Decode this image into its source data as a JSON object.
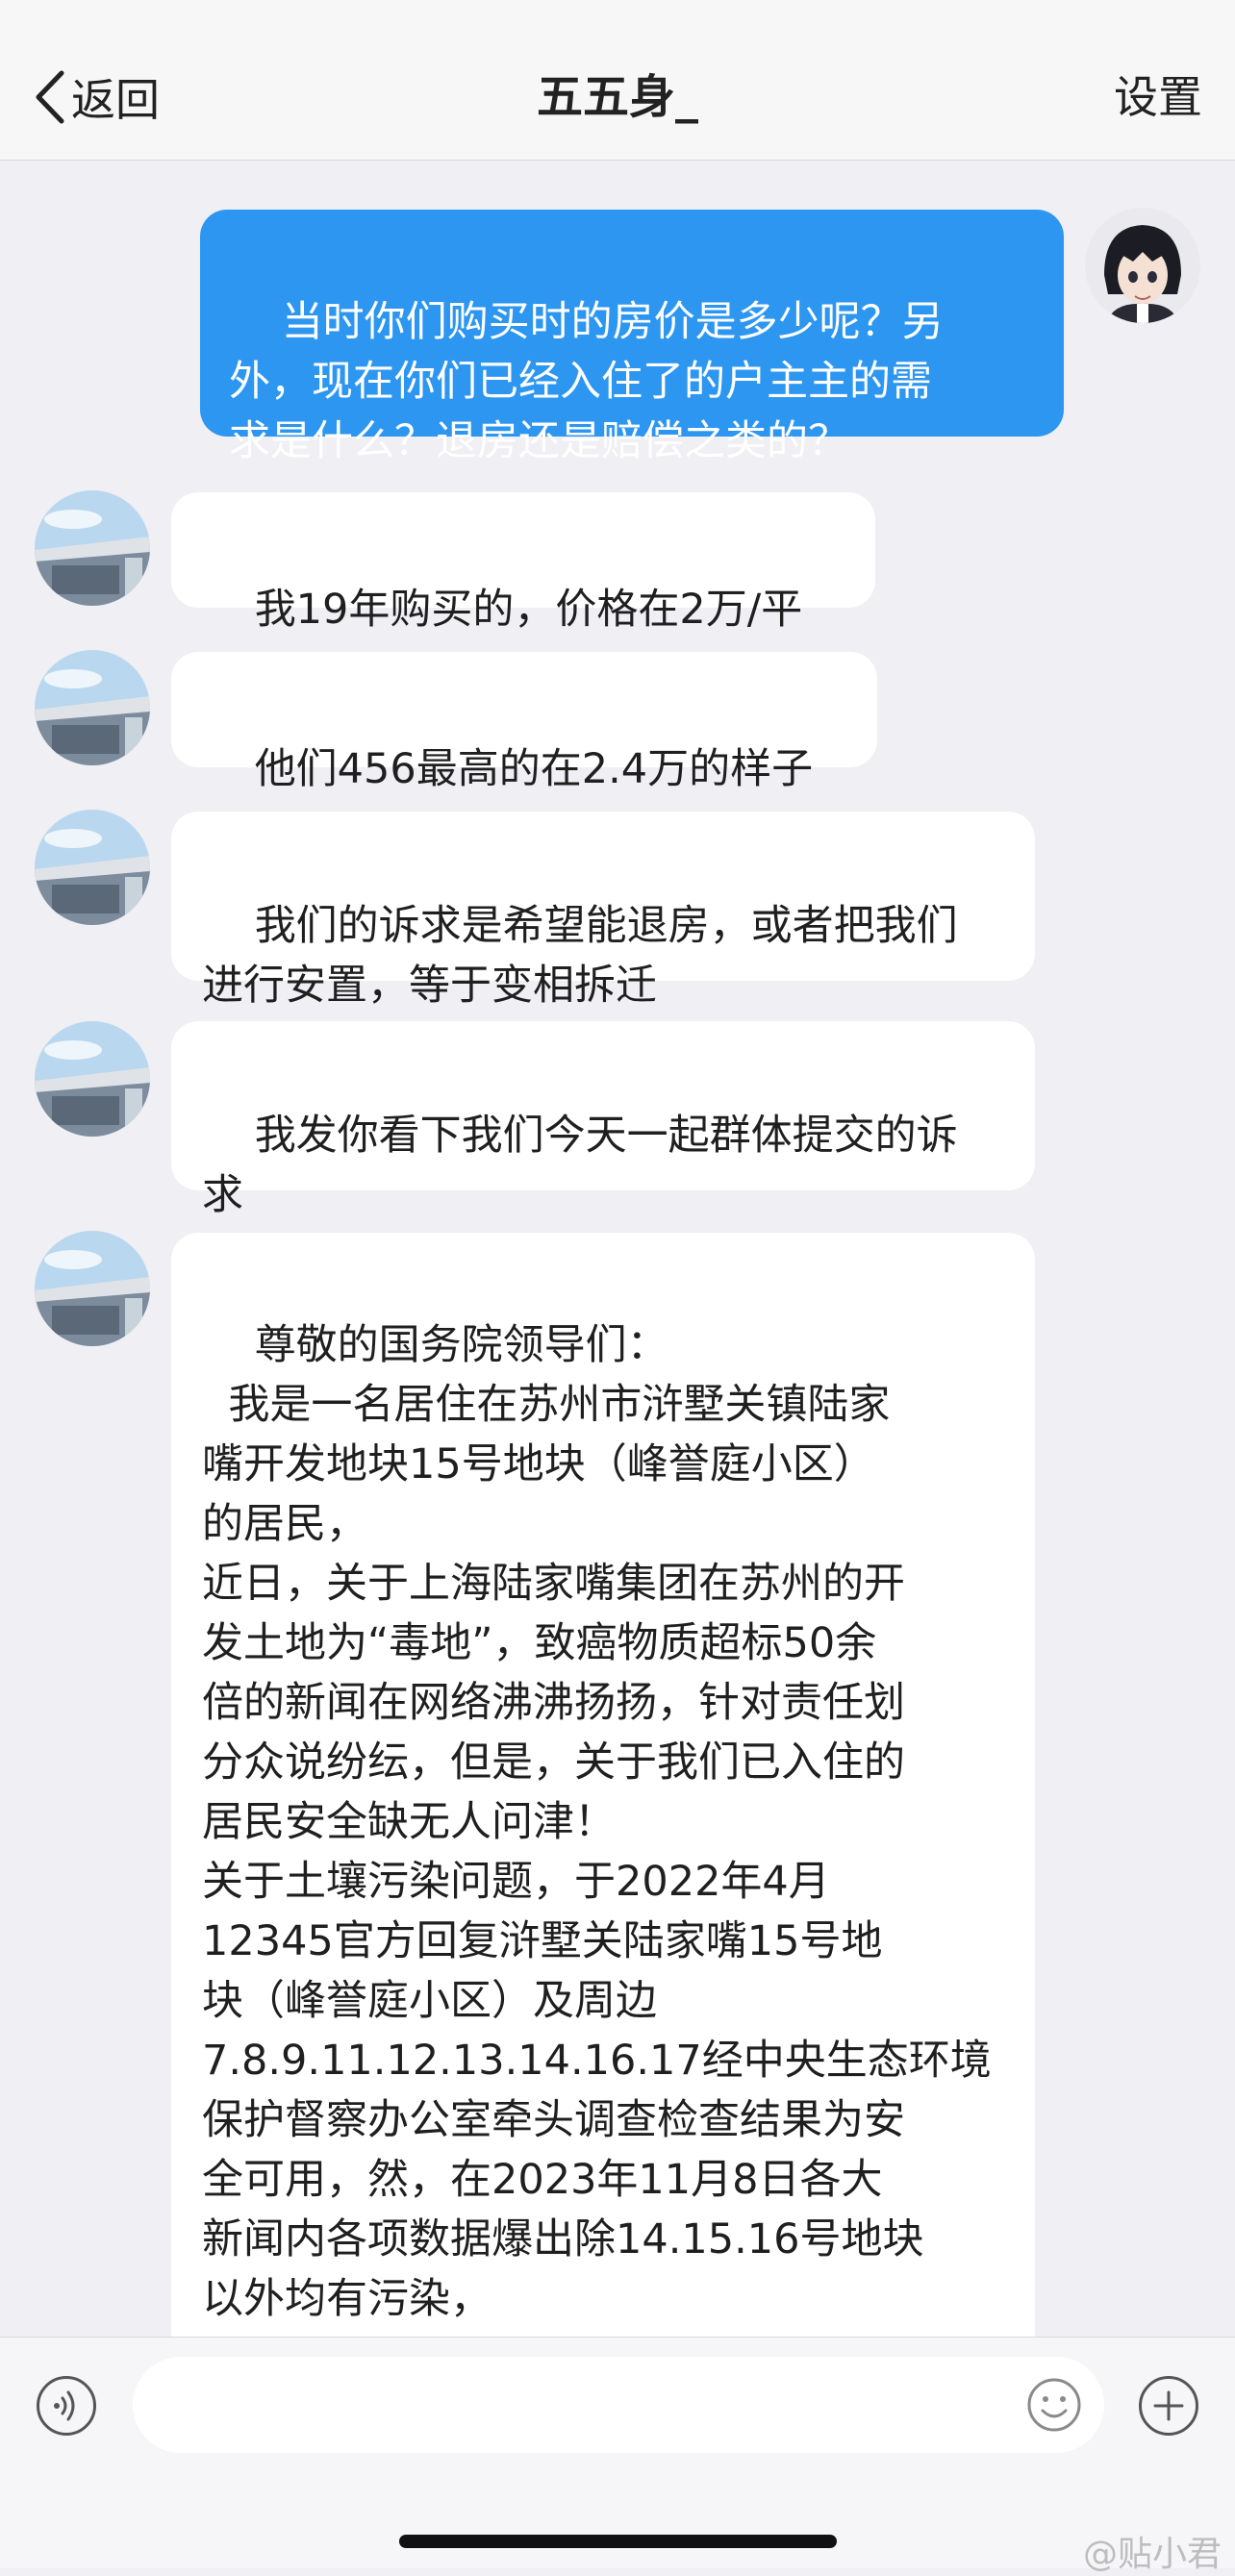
{
  "nav": {
    "back_label": "返回",
    "title": "五五身_",
    "settings_label": "设置"
  },
  "messages": [
    {
      "sender": "me",
      "text": "当时你们购买时的房价是多少呢？另\n外，现在你们已经入住了的户主主的需\n求是什么？退房还是赔偿之类的？"
    },
    {
      "sender": "other",
      "text": "我19年购买的，价格在2万/平"
    },
    {
      "sender": "other",
      "text": "他们456最高的在2.4万的样子"
    },
    {
      "sender": "other",
      "text": "我们的诉求是希望能退房，或者把我们\n进行安置，等于变相拆迁"
    },
    {
      "sender": "other",
      "text": "我发你看下我们今天一起群体提交的诉\n求"
    },
    {
      "sender": "other",
      "text": "尊敬的国务院领导们：\n  我是一名居住在苏州市浒墅关镇陆家\n嘴开发地块15号地块（峰誉庭小区）\n的居民，\n近日，关于上海陆家嘴集团在苏州的开\n发土地为“毒地”，致癌物质超标50余\n倍的新闻在网络沸沸扬扬，针对责任划\n分众说纷纭，但是，关于我们已入住的\n居民安全缺无人问津！\n关于土壤污染问题，于2022年4月\n12345官方回复浒墅关陆家嘴15号地\n块（峰誉庭小区）及周边\n7.8.9.11.12.13.14.16.17经中央生态环境\n保护督察办公室牵头调查检查结果为安\n全可用，然，在2023年11月8日各大\n新闻内各项数据爆出除14.15.16号地块\n以外均有污染，\n污染范围一直在扩大并且污染物致癌物"
    }
  ],
  "input": {
    "placeholder": ""
  },
  "icons": {
    "back": "chevron-left-icon",
    "voice": "voice-icon",
    "emoji": "emoji-icon",
    "add": "plus-icon"
  },
  "colors": {
    "my_bubble": "#2c96f1",
    "other_bubble": "#ffffff",
    "background": "#efeff4"
  },
  "watermark": "@贴小君"
}
